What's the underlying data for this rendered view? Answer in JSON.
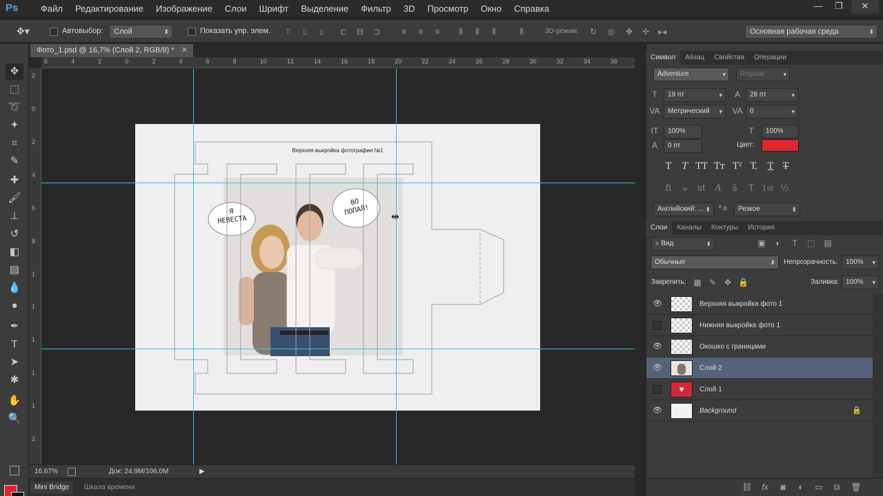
{
  "app": {
    "logo": "Ps"
  },
  "menu": [
    "Файл",
    "Редактирование",
    "Изображение",
    "Слои",
    "Шрифт",
    "Выделение",
    "Фильтр",
    "3D",
    "Просмотр",
    "Окно",
    "Справка"
  ],
  "window_controls": {
    "minimize": "—",
    "restore": "❐",
    "close": "✕"
  },
  "options": {
    "autoselect_label": "Автовыбор:",
    "autoselect_value": "Слой",
    "show_controls_label": "Показать упр. элем.",
    "mode3d_label": "3D-режим:",
    "workspace": "Основная рабочая среда"
  },
  "document": {
    "tab_title": "Фото_1.psd @ 16,7% (Слой 2, RGB/8) *",
    "close": "✕",
    "heading": "Верхняя выкройка фотографии №1",
    "bubble_left": "Я НЕВЕСТА",
    "bubble_right": "ВО ПОПАЛ!"
  },
  "ruler_top_ticks": [
    "6",
    "4",
    "2",
    "0",
    "2",
    "4",
    "6",
    "8",
    "10",
    "12",
    "14",
    "16",
    "18",
    "20",
    "22",
    "24",
    "26",
    "28",
    "30",
    "32",
    "34",
    "36"
  ],
  "ruler_left_ticks": [
    "2",
    "0",
    "2",
    "4",
    "6",
    "8",
    "1",
    "1",
    "1",
    "1",
    "1",
    "2"
  ],
  "status": {
    "zoom": "16,67%",
    "doc_info": "Док: 24,9M/106,0M"
  },
  "bottom_tabs": [
    "Mini Bridge",
    "Шкала времени"
  ],
  "character_panel": {
    "tabs": [
      "Символ",
      "Абзац",
      "Свойства",
      "Операции"
    ],
    "font_family": "Adventure",
    "font_style": "Regular",
    "font_size": "19 пт",
    "leading": "28 пт",
    "kerning": "Метрический",
    "tracking": "0",
    "vscale": "100%",
    "hscale": "100%",
    "baseline": "0 пт",
    "color_label": "Цвет:",
    "color_value": "#e0262f",
    "language": "Английский: ...",
    "aa_label": "a",
    "antialias": "Резкое",
    "type_buttons": [
      "T",
      "T",
      "TT",
      "Tт",
      "T²",
      "T,",
      "T",
      "T"
    ],
    "opentype_buttons": [
      "fi",
      "ℴ",
      "st",
      "A",
      "ā",
      "T",
      "1st",
      "½"
    ]
  },
  "layers_panel": {
    "tabs": [
      "Слои",
      "Каналы",
      "Контуры",
      "История"
    ],
    "filter_kind": "Вид",
    "blend_mode": "Обычные",
    "opacity_label": "Непрозрачность:",
    "opacity_value": "100%",
    "lock_label": "Закрепить:",
    "fill_label": "Заливка:",
    "fill_value": "100%",
    "layers": [
      {
        "name": "Верхняя выкройка фото 1",
        "visible": true,
        "italic": false,
        "selected": false,
        "thumb": "checker"
      },
      {
        "name": "Нижняя выкройка фото 1",
        "visible": false,
        "italic": false,
        "selected": false,
        "thumb": "checker"
      },
      {
        "name": "Окошко с границами",
        "visible": true,
        "italic": false,
        "selected": false,
        "thumb": "checker"
      },
      {
        "name": "Слой 2",
        "visible": true,
        "italic": false,
        "selected": true,
        "thumb": "photo"
      },
      {
        "name": "Слой 1",
        "visible": false,
        "italic": false,
        "selected": false,
        "thumb": "red"
      },
      {
        "name": "Background",
        "visible": true,
        "italic": true,
        "selected": false,
        "thumb": "white"
      }
    ]
  }
}
